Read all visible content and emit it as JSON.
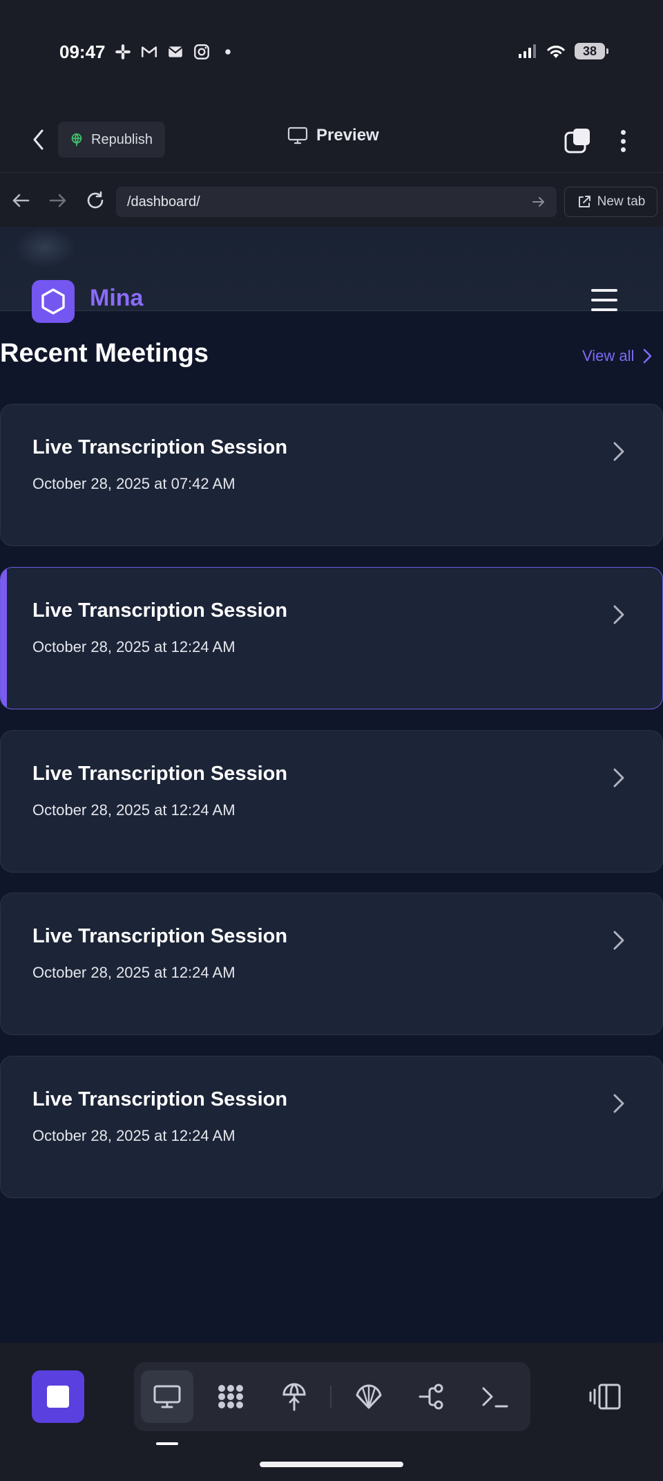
{
  "status_bar": {
    "time": "09:47",
    "notification_icons": [
      "slack-icon",
      "gmail-icon",
      "mail-icon",
      "instagram-icon",
      "dot-icon"
    ],
    "battery": "38"
  },
  "toolbar": {
    "republish_label": "Republish",
    "preview_label": "Preview"
  },
  "url_bar": {
    "url": "/dashboard/",
    "new_tab_label": "New tab"
  },
  "site": {
    "brand": "Mina",
    "section_title": "Recent Meetings",
    "view_all_label": "View all"
  },
  "meetings": [
    {
      "title": "Live Transcription Session",
      "date": "October 28, 2025 at 07:42 AM",
      "active": false
    },
    {
      "title": "Live Transcription Session",
      "date": "October 28, 2025 at 12:24 AM",
      "active": true
    },
    {
      "title": "Live Transcription Session",
      "date": "October 28, 2025 at 12:24 AM",
      "active": false
    },
    {
      "title": "Live Transcription Session",
      "date": "October 28, 2025 at 12:24 AM",
      "active": false
    },
    {
      "title": "Live Transcription Session",
      "date": "October 28, 2025 at 12:24 AM",
      "active": false
    }
  ],
  "bottom_tools": [
    "desktop-icon",
    "apps-icon",
    "deploy-icon",
    "shell-icon",
    "share-graph-icon",
    "terminal-icon"
  ],
  "colors": {
    "accent": "#7457f0",
    "link": "#7d6bf6",
    "card_bg": "#1c2437",
    "page_bg": "#101629"
  }
}
